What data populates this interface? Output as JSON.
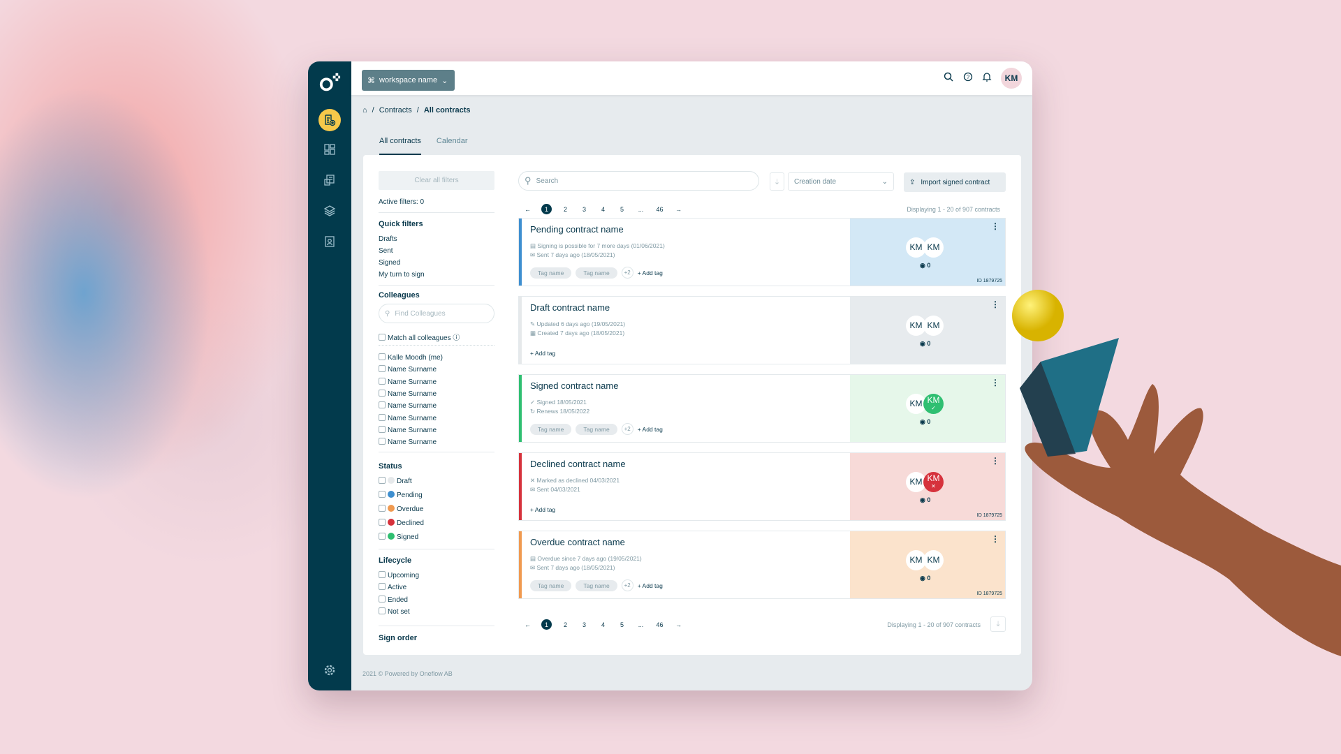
{
  "colors": {
    "sidebar": "#023a4c",
    "accent": "#f5c84a",
    "draft": "#e6e9eb",
    "pending": "#3e8fd0",
    "overdue": "#f09a50",
    "declined": "#d6323c",
    "signed": "#2fbf71"
  },
  "sidebar": {
    "icons": [
      "logo",
      "new-contract-icon",
      "dashboard-icon",
      "contracts-icon",
      "templates-icon",
      "address-book-icon",
      "gear-icon"
    ]
  },
  "topbar": {
    "workspace": "workspace name",
    "avatar": "KM"
  },
  "breadcrumb": [
    "Contracts",
    "All contracts"
  ],
  "tabs": [
    {
      "label": "All contracts",
      "active": true
    },
    {
      "label": "Calendar",
      "active": false
    }
  ],
  "filters": {
    "clear": "Clear all filters",
    "active": "Active filters: 0",
    "quick_title": "Quick filters",
    "quick": [
      "Drafts",
      "Sent",
      "Signed",
      "My turn to sign"
    ],
    "colleagues_title": "Colleagues",
    "find_placeholder": "Find Colleagues",
    "match_all": "Match all colleagues",
    "colleagues": [
      "Kalle Moodh (me)",
      "Name Surname",
      "Name Surname",
      "Name Surname",
      "Name Surname",
      "Name Surname",
      "Name Surname",
      "Name Surname"
    ],
    "status_title": "Status",
    "status": [
      {
        "label": "Draft",
        "color": "#e6e9eb"
      },
      {
        "label": "Pending",
        "color": "#3e8fd0"
      },
      {
        "label": "Overdue",
        "color": "#f09a50"
      },
      {
        "label": "Declined",
        "color": "#d6323c"
      },
      {
        "label": "Signed",
        "color": "#2fbf71"
      }
    ],
    "lifecycle_title": "Lifecycle",
    "lifecycle": [
      "Upcoming",
      "Active",
      "Ended",
      "Not set"
    ],
    "sign_order": "Sign order"
  },
  "toolbar": {
    "search_placeholder": "Search",
    "sort_by": "Creation date",
    "import": "Import signed contract"
  },
  "pagination": {
    "pages": [
      "1",
      "2",
      "3",
      "4",
      "5",
      "...",
      "46"
    ],
    "current": "1",
    "display": "Displaying 1 - 20 of 907 contracts"
  },
  "contracts": [
    {
      "title": "Pending contract name",
      "meta": [
        "Signing is possible for 7 more days (01/06/2021)",
        "Sent 7 days ago (18/05/2021)"
      ],
      "icons": [
        "calendar-icon",
        "sent-icon"
      ],
      "tags": [
        "Tag name",
        "Tag name"
      ],
      "more": "+2",
      "add_tag": "+ Add tag",
      "color": "#3e8fd0",
      "bg": "#d3e8f6",
      "participants": [
        {
          "initials": "KM",
          "state": "none"
        },
        {
          "initials": "KM",
          "state": "none"
        }
      ],
      "views": "0",
      "id": "ID 1879725"
    },
    {
      "title": "Draft contract name",
      "meta": [
        "Updated 6 days ago (19/05/2021)",
        "Created 7 days ago (18/05/2021)"
      ],
      "icons": [
        "edit-icon",
        "created-icon"
      ],
      "tags": [],
      "add_tag": "+ Add tag",
      "color": "#e6e9eb",
      "bg": "#e7ebee",
      "participants": [
        {
          "initials": "KM",
          "state": "none"
        },
        {
          "initials": "KM",
          "state": "none"
        }
      ],
      "views": "0"
    },
    {
      "title": "Signed contract name",
      "meta": [
        "Signed 18/05/2021",
        "Renews 18/05/2022"
      ],
      "icons": [
        "check-icon",
        "renew-icon"
      ],
      "tags": [
        "Tag name",
        "Tag name"
      ],
      "more": "+2",
      "add_tag": "+ Add tag",
      "color": "#2fbf71",
      "bg": "#e6f7ea",
      "participants": [
        {
          "initials": "KM",
          "state": "none"
        },
        {
          "initials": "KM",
          "state": "signed"
        }
      ],
      "views": "0"
    },
    {
      "title": "Declined contract name",
      "meta": [
        "Marked as declined 04/03/2021",
        "Sent 04/03/2021"
      ],
      "icons": [
        "x-icon",
        "sent-icon"
      ],
      "tags": [],
      "add_tag": "+ Add tag",
      "color": "#d6323c",
      "bg": "#f7dad8",
      "participants": [
        {
          "initials": "KM",
          "state": "none"
        },
        {
          "initials": "KM",
          "state": "declined"
        }
      ],
      "views": "0",
      "id": "ID 1879725"
    },
    {
      "title": "Overdue contract name",
      "meta": [
        "Overdue since 7 days ago (19/05/2021)",
        "Sent 7 days ago (18/05/2021)"
      ],
      "icons": [
        "overdue-icon",
        "sent-icon"
      ],
      "tags": [
        "Tag name",
        "Tag name"
      ],
      "more": "+2",
      "add_tag": "+ Add tag",
      "color": "#f09a50",
      "bg": "#fbe3cc",
      "participants": [
        {
          "initials": "KM",
          "state": "none"
        },
        {
          "initials": "KM",
          "state": "none"
        }
      ],
      "views": "0",
      "id": "ID 1879725"
    }
  ],
  "footer": "2021 © Powered by Oneflow AB"
}
